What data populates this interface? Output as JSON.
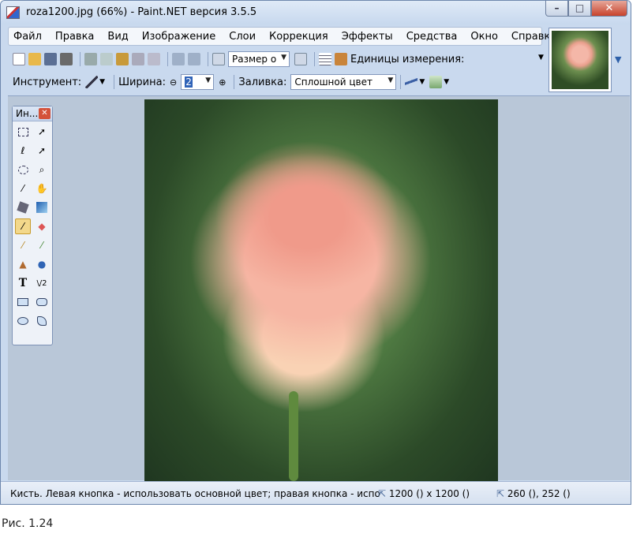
{
  "window": {
    "title": "roza1200.jpg (66%) - Paint.NET версия 3.5.5"
  },
  "menu": [
    "Файл",
    "Правка",
    "Вид",
    "Изображение",
    "Слои",
    "Коррекция",
    "Эффекты",
    "Средства",
    "Окно",
    "Справка"
  ],
  "toolbar1": {
    "zoom_value": "Размер о",
    "units_label": "Единицы измерения:"
  },
  "toolbar2": {
    "tool_label": "Инструмент:",
    "width_label": "Ширина:",
    "width_value": "2",
    "fill_label": "Заливка:",
    "fill_value": "Сплошной цвет"
  },
  "tools_panel": {
    "title": "Ин..."
  },
  "status": {
    "text": "Кисть. Левая кнопка - использовать основной цвет; правая кнопка - испо",
    "size": "1200 () x 1200 ()",
    "position": "260 (), 252 ()"
  },
  "caption": "Рис. 1.24",
  "colors": {
    "window_bg": "#c9d9ee",
    "canvas_bg": "#b9c7d8",
    "close_red": "#c8432c",
    "active_tool": "#f3d88b"
  }
}
